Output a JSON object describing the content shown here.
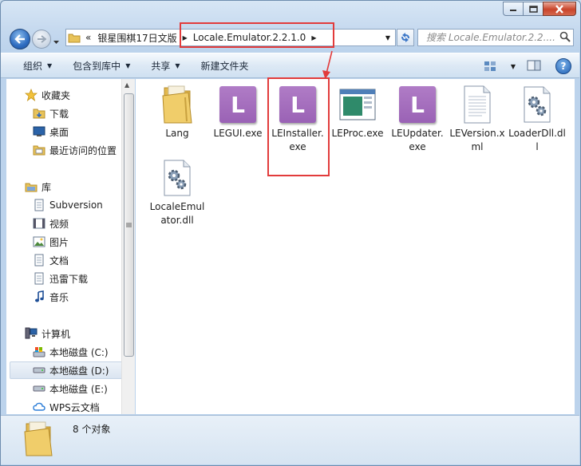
{
  "window": {
    "caption": {
      "minimize": "minimize",
      "maximize": "maximize",
      "close": "close"
    }
  },
  "address": {
    "overflow": "«",
    "segments": [
      "银星围棋17日文版",
      "Locale.Emulator.2.2.1.0"
    ]
  },
  "search": {
    "placeholder": "搜索 Locale.Emulator.2.2...."
  },
  "toolbar": {
    "organize": "组织",
    "include_library": "包含到库中",
    "share": "共享",
    "new_folder": "新建文件夹",
    "help": "?"
  },
  "nav": {
    "favorites": "收藏夹",
    "downloads": "下载",
    "desktop": "桌面",
    "recent": "最近访问的位置",
    "libraries": "库",
    "subversion": "Subversion",
    "videos": "视频",
    "pictures": "图片",
    "documents": "文档",
    "xunlei": "迅雷下载",
    "music": "音乐",
    "computer": "计算机",
    "drive_c": "本地磁盘 (C:)",
    "drive_d": "本地磁盘 (D:)",
    "drive_e": "本地磁盘 (E:)",
    "wps": "WPS云文档"
  },
  "files": [
    {
      "name": "Lang",
      "type": "folder"
    },
    {
      "name": "LEGUI.exe",
      "type": "le"
    },
    {
      "name": "LEInstaller.exe",
      "type": "le"
    },
    {
      "name": "LEProc.exe",
      "type": "window"
    },
    {
      "name": "LEUpdater.exe",
      "type": "le"
    },
    {
      "name": "LEVersion.xml",
      "type": "document"
    },
    {
      "name": "LoaderDll.dll",
      "type": "dll"
    },
    {
      "name": "LocaleEmulator.dll",
      "type": "dll"
    }
  ],
  "le_letter": "L",
  "status": {
    "count": "8 个对象"
  },
  "colors": {
    "highlight": "#e23b3b",
    "le_purple": "#a46fbe"
  }
}
